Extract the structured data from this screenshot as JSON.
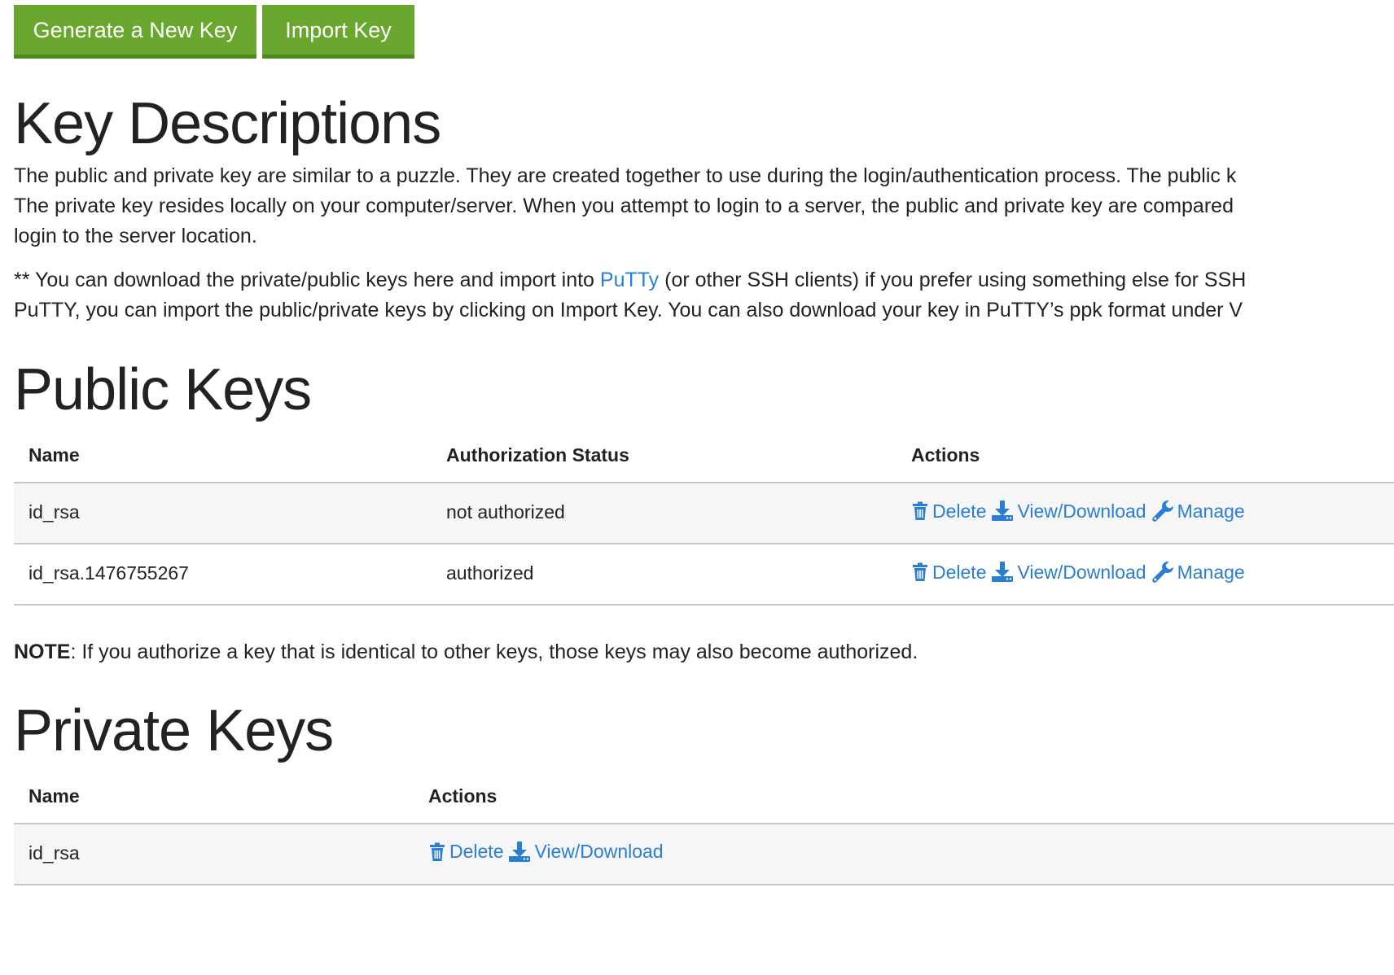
{
  "toolbar": {
    "generate_label": "Generate a New Key",
    "import_label": "Import Key"
  },
  "key_descriptions": {
    "title": "Key Descriptions",
    "paragraph_lines": [
      "The public and private key are similar to a puzzle. They are created together to use during the login/authentication process. The public k",
      "The private key resides locally on your computer/server. When you attempt to login to a server, the public and private key are compared",
      "login to the server location."
    ],
    "download_line1_prefix": "** You can download the private/public keys here and import into ",
    "download_link": "PuTTy",
    "download_line1_suffix": " (or other SSH clients) if you prefer using something else for SSH",
    "download_line2": "PuTTY, you can import the public/private keys by clicking on Import Key. You can also download your key in PuTTY’s ppk format under V"
  },
  "public_keys": {
    "title": "Public Keys",
    "columns": {
      "name": "Name",
      "status": "Authorization Status",
      "actions": "Actions"
    },
    "rows": [
      {
        "name": "id_rsa",
        "status": "not authorized"
      },
      {
        "name": "id_rsa.1476755267",
        "status": "authorized"
      }
    ],
    "actions": {
      "delete": "Delete",
      "view_download": "View/Download",
      "manage": "Manage"
    }
  },
  "note": {
    "label": "NOTE",
    "text": ": If you authorize a key that is identical to other keys, those keys may also become authorized."
  },
  "private_keys": {
    "title": "Private Keys",
    "columns": {
      "name": "Name",
      "actions": "Actions"
    },
    "rows": [
      {
        "name": "id_rsa"
      }
    ],
    "actions": {
      "delete": "Delete",
      "view_download": "View/Download"
    }
  },
  "colors": {
    "button_green": "#6aa72f",
    "button_border": "#4e8a1f",
    "link_blue": "#2a7fd4",
    "row_alt_bg": "#f6f6f6",
    "divider": "#c7c7c7"
  },
  "icons": [
    "trash-icon",
    "download-icon",
    "wrench-icon"
  ]
}
